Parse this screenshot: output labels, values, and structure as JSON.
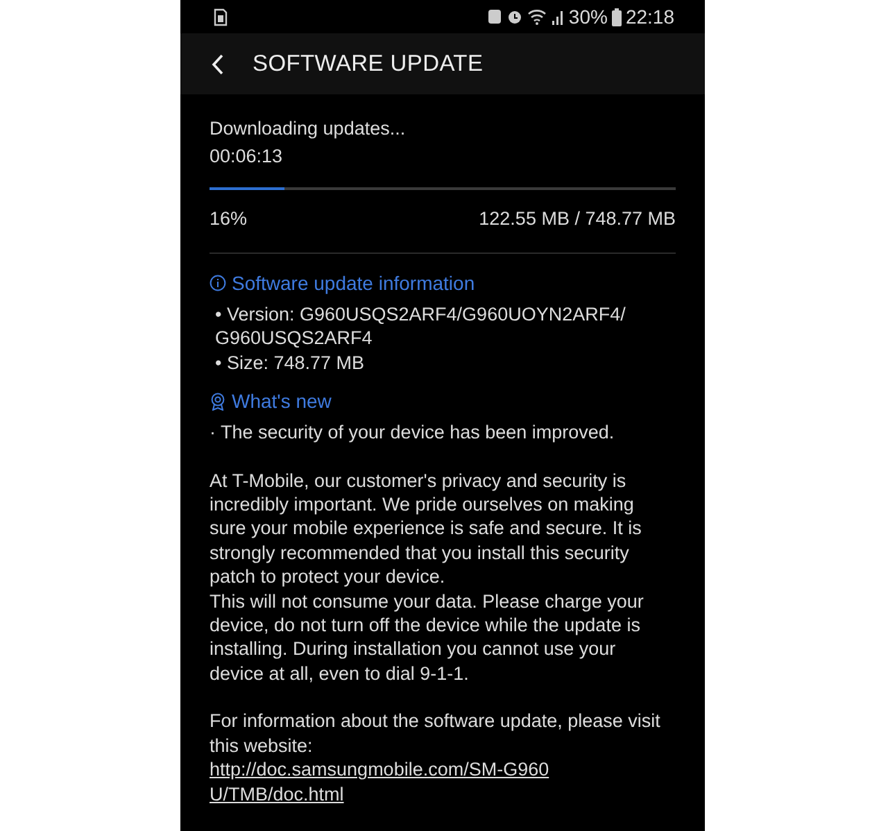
{
  "status_bar": {
    "battery_percent": "30%",
    "time": "22:18"
  },
  "header": {
    "title": "SOFTWARE UPDATE"
  },
  "download": {
    "status": "Downloading updates...",
    "elapsed": "00:06:13",
    "level": 0.16,
    "percent": "16%",
    "size_progress": "122.55 MB / 748.77 MB"
  },
  "update_info": {
    "title": "Software update information",
    "items": [
      "• Version: G960USQS2ARF4/G960UOYN2ARF4/ G960USQS2ARF4",
      "• Size: 748.77 MB"
    ]
  },
  "whats_new": {
    "title": "What's new",
    "paragraphs": [
      "· The security of your device has been improved.",
      "At T-Mobile, our customer's privacy and security is incredibly important. We pride ourselves on making sure your mobile experience is safe and secure. It is strongly recommended that you install this security patch to protect your device.\n This will not consume your data.  Please charge your device,  do not turn off the device while the update is installing. During installation you cannot use your device at all, even to dial 9-1-1.",
      "For information about the software update, please visit this website:"
    ],
    "link": "http://doc.samsungmobile.com/SM-G960U/TMB/doc.html"
  }
}
